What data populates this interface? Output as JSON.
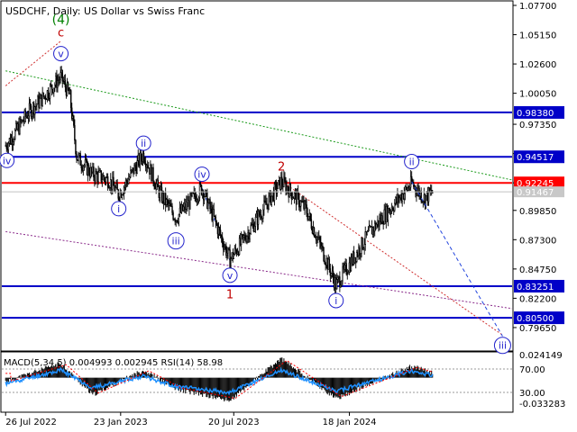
{
  "header": {
    "symbol_line": "USDCHF, Daily:  US Dollar vs Swiss Franc"
  },
  "colors": {
    "candle": "#000000",
    "level_blue": "#0000c8",
    "level_red": "#ff0000",
    "wave_blue": "#2222cc",
    "wave_red": "#c00000",
    "wave_green": "#008000",
    "dotted_red": "#d03030",
    "dotted_green": "#1a9a1a",
    "dotted_purple": "#8a2a8a",
    "dashed_blue": "#2244dd",
    "macd_hist": "#000000",
    "macd_signal": "#ff0000",
    "rsi": "#1e90ff"
  },
  "chart_data": [
    {
      "type": "candlestick",
      "title": "USDCHF, Daily:  US Dollar vs Swiss Franc",
      "ylim": [
        0.78,
        1.077
      ],
      "y_ticks": [
        "1.07700",
        "1.05150",
        "1.02600",
        "1.00050",
        "0.97350",
        "0.94800",
        "0.92250",
        "0.89850",
        "0.87300",
        "0.84750",
        "0.82200",
        "0.79650"
      ],
      "x_ticks": [
        "26 Jul 2022",
        "23 Jan 2023",
        "20 Jul 2023",
        "18 Jan 2024"
      ],
      "price_path_approx": [
        {
          "t": "2022-07-26",
          "close": 0.955
        },
        {
          "t": "2022-08-05",
          "close": 0.962
        },
        {
          "t": "2022-09-01",
          "close": 0.985
        },
        {
          "t": "2022-09-20",
          "close": 0.995
        },
        {
          "t": "2022-10-21",
          "close": 1.0148
        },
        {
          "t": "2022-11-04",
          "close": 0.998
        },
        {
          "t": "2022-11-15",
          "close": 0.945
        },
        {
          "t": "2022-12-10",
          "close": 0.93
        },
        {
          "t": "2023-01-05",
          "close": 0.925
        },
        {
          "t": "2023-01-20",
          "close": 0.912
        },
        {
          "t": "2023-02-28",
          "close": 0.948
        },
        {
          "t": "2023-03-24",
          "close": 0.915
        },
        {
          "t": "2023-04-20",
          "close": 0.892
        },
        {
          "t": "2023-05-31",
          "close": 0.918
        },
        {
          "t": "2023-07-14",
          "close": 0.8555
        },
        {
          "t": "2023-08-10",
          "close": 0.878
        },
        {
          "t": "2023-10-03",
          "close": 0.924
        },
        {
          "t": "2023-11-10",
          "close": 0.9
        },
        {
          "t": "2023-12-28",
          "close": 0.8335
        },
        {
          "t": "2024-02-20",
          "close": 0.88
        },
        {
          "t": "2024-04-25",
          "close": 0.922
        },
        {
          "t": "2024-05-15",
          "close": 0.909
        },
        {
          "t": "2024-05-28",
          "close": 0.9148
        }
      ],
      "levels": [
        {
          "label": "0.98380",
          "value": 0.9838,
          "color": "#0000c8"
        },
        {
          "label": "0.94517",
          "value": 0.94517,
          "color": "#0000c8"
        },
        {
          "label": "0.92245",
          "value": 0.92245,
          "color": "#ff0000"
        },
        {
          "label": "0.83251",
          "value": 0.83251,
          "color": "#0000c8"
        },
        {
          "label": "0.80500",
          "value": 0.805,
          "color": "#0000c8"
        }
      ],
      "current_price_label": "0.91467",
      "current_price": 0.91467,
      "wave_labels": [
        {
          "text": "(4)",
          "style": "green",
          "t": "2022-10-21",
          "price": 1.065
        },
        {
          "text": "c",
          "style": "red",
          "t": "2022-10-21",
          "price": 1.054
        },
        {
          "text": "v",
          "style": "circle",
          "t": "2022-10-21",
          "price": 1.035
        },
        {
          "text": "iv",
          "style": "circle",
          "t": "2022-07-28",
          "price": 0.942
        },
        {
          "text": "ii",
          "style": "circle",
          "t": "2023-02-28",
          "price": 0.957
        },
        {
          "text": "i",
          "style": "circle",
          "t": "2023-01-20",
          "price": 0.9
        },
        {
          "text": "iii",
          "style": "circle",
          "t": "2023-04-20",
          "price": 0.872
        },
        {
          "text": "iv",
          "style": "circle",
          "t": "2023-05-31",
          "price": 0.93
        },
        {
          "text": "v",
          "style": "circle",
          "t": "2023-07-14",
          "price": 0.842
        },
        {
          "text": "1",
          "style": "red",
          "t": "2023-07-14",
          "price": 0.826
        },
        {
          "text": "2",
          "style": "red",
          "t": "2023-10-03",
          "price": 0.937
        },
        {
          "text": "i",
          "style": "circle",
          "t": "2023-12-28",
          "price": 0.82
        },
        {
          "text": "ii",
          "style": "circle",
          "t": "2024-04-25",
          "price": 0.941
        },
        {
          "text": "iii",
          "style": "circle",
          "t": "2024-09-15",
          "price": 0.781
        }
      ],
      "forecast_path": [
        {
          "t": "2024-04-25",
          "price": 0.9235
        },
        {
          "t": "2024-09-15",
          "price": 0.789
        }
      ],
      "trendlines": [
        {
          "style": "dotted-green",
          "from": {
            "t": "2022-07-26",
            "price": 1.02
          },
          "to": {
            "t": "2024-09-30",
            "price": 0.925
          }
        },
        {
          "style": "dotted-red",
          "from": {
            "t": "2022-07-26",
            "price": 1.007
          },
          "to": {
            "t": "2022-10-21",
            "price": 1.046
          }
        },
        {
          "style": "dotted-purple",
          "from": {
            "t": "2022-07-26",
            "price": 0.88
          },
          "to": {
            "t": "2024-09-30",
            "price": 0.813
          }
        },
        {
          "style": "dotted-red",
          "from": {
            "t": "2023-10-03",
            "price": 0.924
          },
          "to": {
            "t": "2024-09-15",
            "price": 0.79
          }
        },
        {
          "style": "dotted-blue",
          "from": {
            "t": "2023-05-31",
            "price": 0.918
          },
          "to": {
            "t": "2023-07-14",
            "price": 0.855
          }
        }
      ]
    },
    {
      "type": "indicator",
      "title": "MACD(5,34,5) 0.004993 0.002945 RSI(14) 58.98",
      "y_ticks": [
        "0.024149",
        "70.00",
        "30.00",
        "-0.033283"
      ],
      "macd_ylim": [
        -0.033283,
        0.024149
      ],
      "rsi_levels": [
        70,
        30
      ],
      "macd_path_approx": [
        {
          "t": "2022-07-26",
          "v": -0.004
        },
        {
          "t": "2022-10-21",
          "v": 0.015
        },
        {
          "t": "2022-12-10",
          "v": -0.018
        },
        {
          "t": "2023-02-28",
          "v": 0.008
        },
        {
          "t": "2023-04-20",
          "v": -0.012
        },
        {
          "t": "2023-07-14",
          "v": -0.024
        },
        {
          "t": "2023-10-03",
          "v": 0.02
        },
        {
          "t": "2023-12-28",
          "v": -0.022
        },
        {
          "t": "2024-04-25",
          "v": 0.012
        },
        {
          "t": "2024-05-28",
          "v": 0.005
        }
      ],
      "rsi_path_approx": [
        {
          "t": "2022-07-26",
          "v": 45
        },
        {
          "t": "2022-10-21",
          "v": 68
        },
        {
          "t": "2022-12-10",
          "v": 38
        },
        {
          "t": "2023-02-28",
          "v": 58
        },
        {
          "t": "2023-04-20",
          "v": 40
        },
        {
          "t": "2023-07-14",
          "v": 30
        },
        {
          "t": "2023-10-03",
          "v": 68
        },
        {
          "t": "2023-12-28",
          "v": 32
        },
        {
          "t": "2024-04-25",
          "v": 67
        },
        {
          "t": "2024-05-28",
          "v": 58.98
        }
      ]
    }
  ]
}
